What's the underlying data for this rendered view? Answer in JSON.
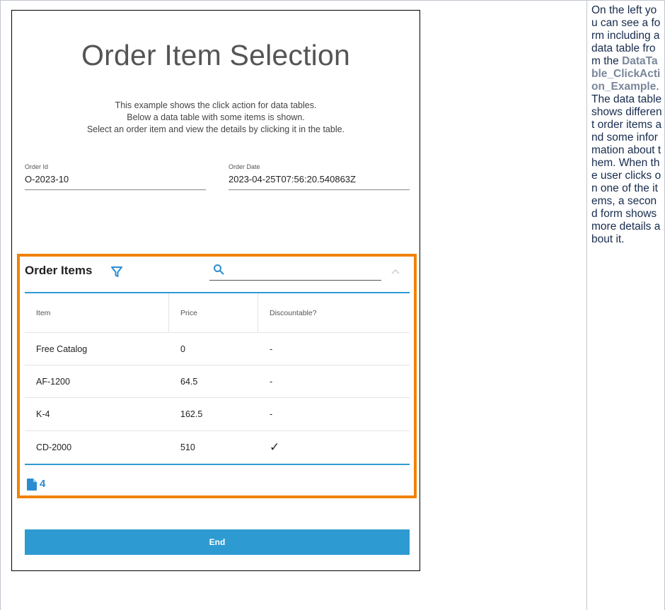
{
  "form": {
    "title": "Order Item Selection",
    "description": [
      "This example shows the click action for data tables.",
      "Below a data table with some items is shown.",
      "Select an order item and view the details by clicking it in the table."
    ],
    "order_id": {
      "label": "Order Id",
      "value": "O-2023-10"
    },
    "order_date": {
      "label": "Order Date",
      "value": "2023-04-25T07:56:20.540863Z"
    },
    "items_title": "Order Items",
    "search": {
      "placeholder": ""
    },
    "table": {
      "headers": [
        "Item",
        "Price",
        "Discountable?"
      ],
      "rows": [
        [
          "Free Catalog",
          "0",
          "-"
        ],
        [
          "AF-1200",
          "64.5",
          "-"
        ],
        [
          "K-4",
          "162.5",
          "-"
        ],
        [
          "CD-2000",
          "510",
          "✓"
        ]
      ]
    },
    "item_count": "4",
    "end_label": "End"
  },
  "side_text": {
    "part1": "On the left you can see a form including a data table from the ",
    "link": "DataTable_ClickAction_Example",
    "part2": ". The data table shows different order items and some information about them. When the user clicks on one of the items, a second form shows more details about it."
  },
  "colors": {
    "accent": "#2d9bd1",
    "highlight": "#f08205"
  }
}
